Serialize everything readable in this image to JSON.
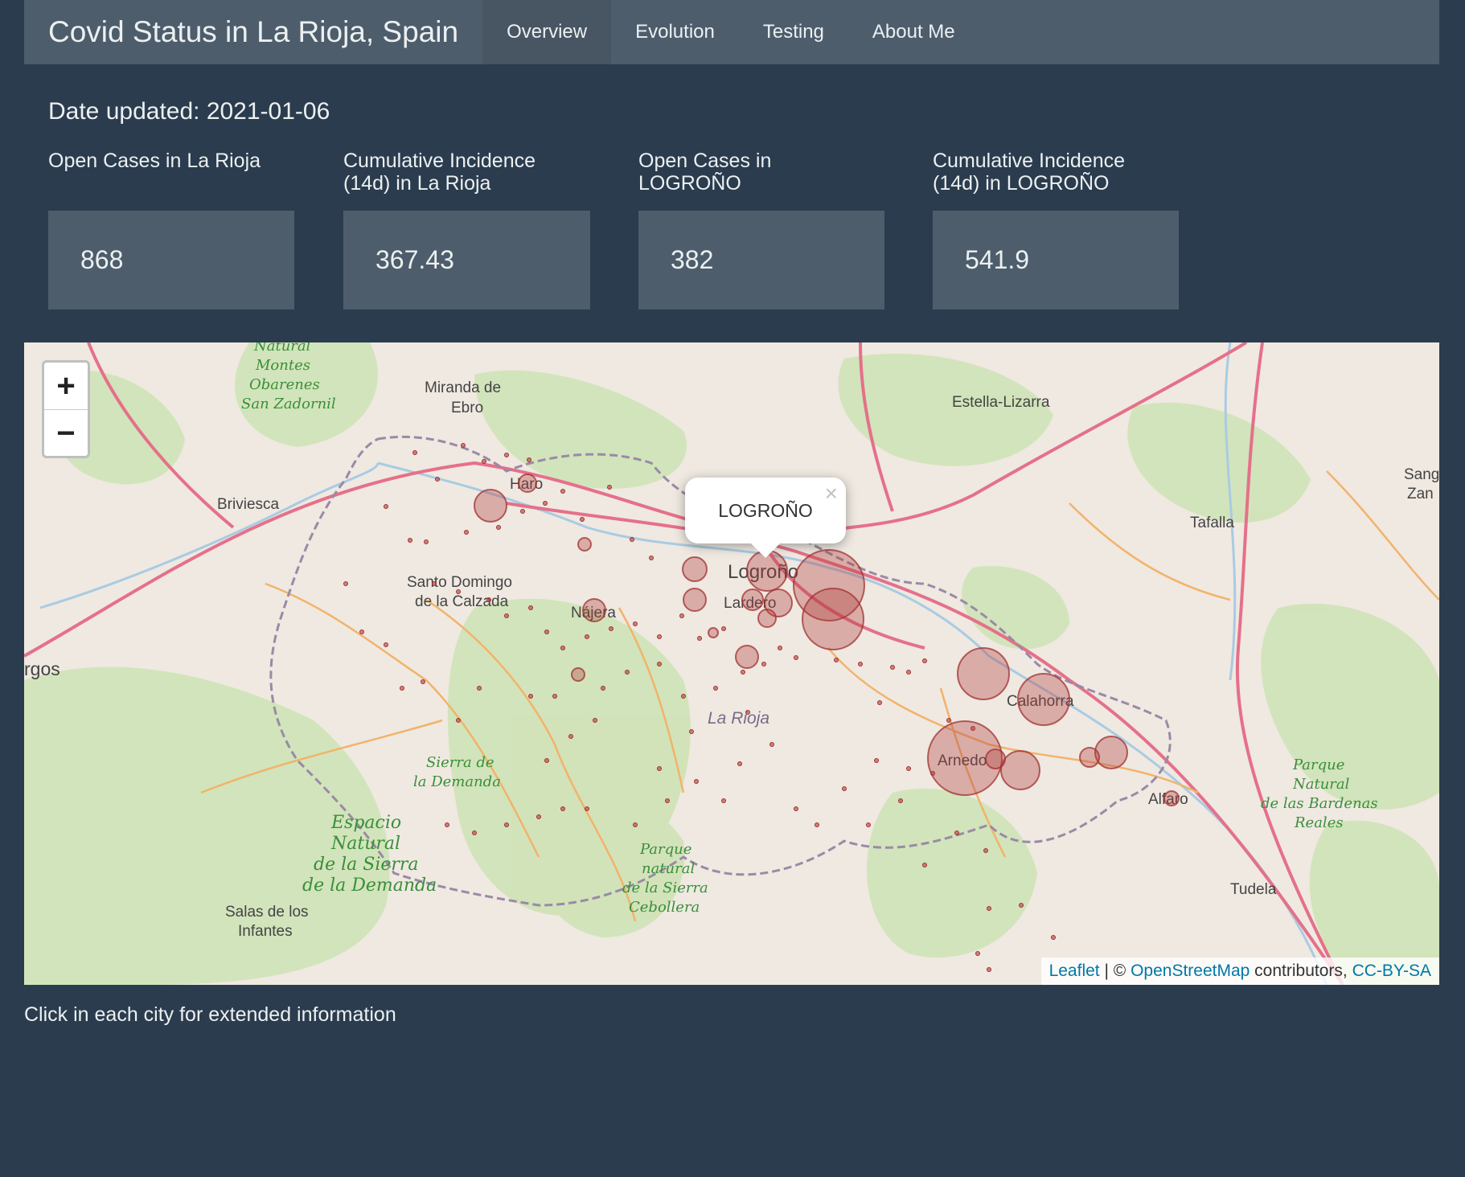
{
  "navbar": {
    "title": "Covid Status in La Rioja, Spain",
    "tabs": [
      {
        "label": "Overview",
        "active": true
      },
      {
        "label": "Evolution",
        "active": false
      },
      {
        "label": "Testing",
        "active": false
      },
      {
        "label": "About Me",
        "active": false
      }
    ]
  },
  "date_updated": "Date updated: 2021-01-06",
  "value_boxes": [
    {
      "label": "Open Cases in La Rioja",
      "value": "868"
    },
    {
      "label": "Cumulative Incidence (14d) in La Rioja",
      "value": "367.43"
    },
    {
      "label": "Open Cases in LOGROÑO",
      "value": "382"
    },
    {
      "label": "Cumulative Incidence (14d) in LOGROÑO",
      "value": "541.9"
    }
  ],
  "map": {
    "zoom_in": "+",
    "zoom_out": "−",
    "popup": {
      "text": "LOGROÑO",
      "close": "×"
    },
    "attribution": {
      "leaflet": "Leaflet",
      "sep": " | © ",
      "osm": "OpenStreetMap",
      "contrib": " contributors, ",
      "license": "CC-BY-SA"
    },
    "places": [
      "Miranda de",
      "Ebro",
      "Haro",
      "Briviesca",
      "Santo Domingo",
      "de la Calzada",
      "Nájera",
      "Logroño",
      "Lardero",
      "Estella-Lizarra",
      "Tafalla",
      "Calahorra",
      "Arnedo",
      "Alfaro",
      "Tudela",
      "La Rioja",
      "rgos",
      "Salas de los",
      "Infantes",
      "Sang",
      "Zan"
    ],
    "parks": [
      "Natural",
      "Montes",
      "Obarenes",
      "San Zadornil",
      "Sierra de",
      "la Demanda",
      "Espacio",
      "Natural",
      "de la Sierra",
      "de la Demanda",
      "Parque",
      "natural",
      "de la Sierra",
      "Cebollera",
      "Parque",
      "Natural",
      "de las Bardenas",
      "Reales"
    ],
    "marker_color": "#b23b3b"
  },
  "footer_note": "Click in each city for extended information"
}
